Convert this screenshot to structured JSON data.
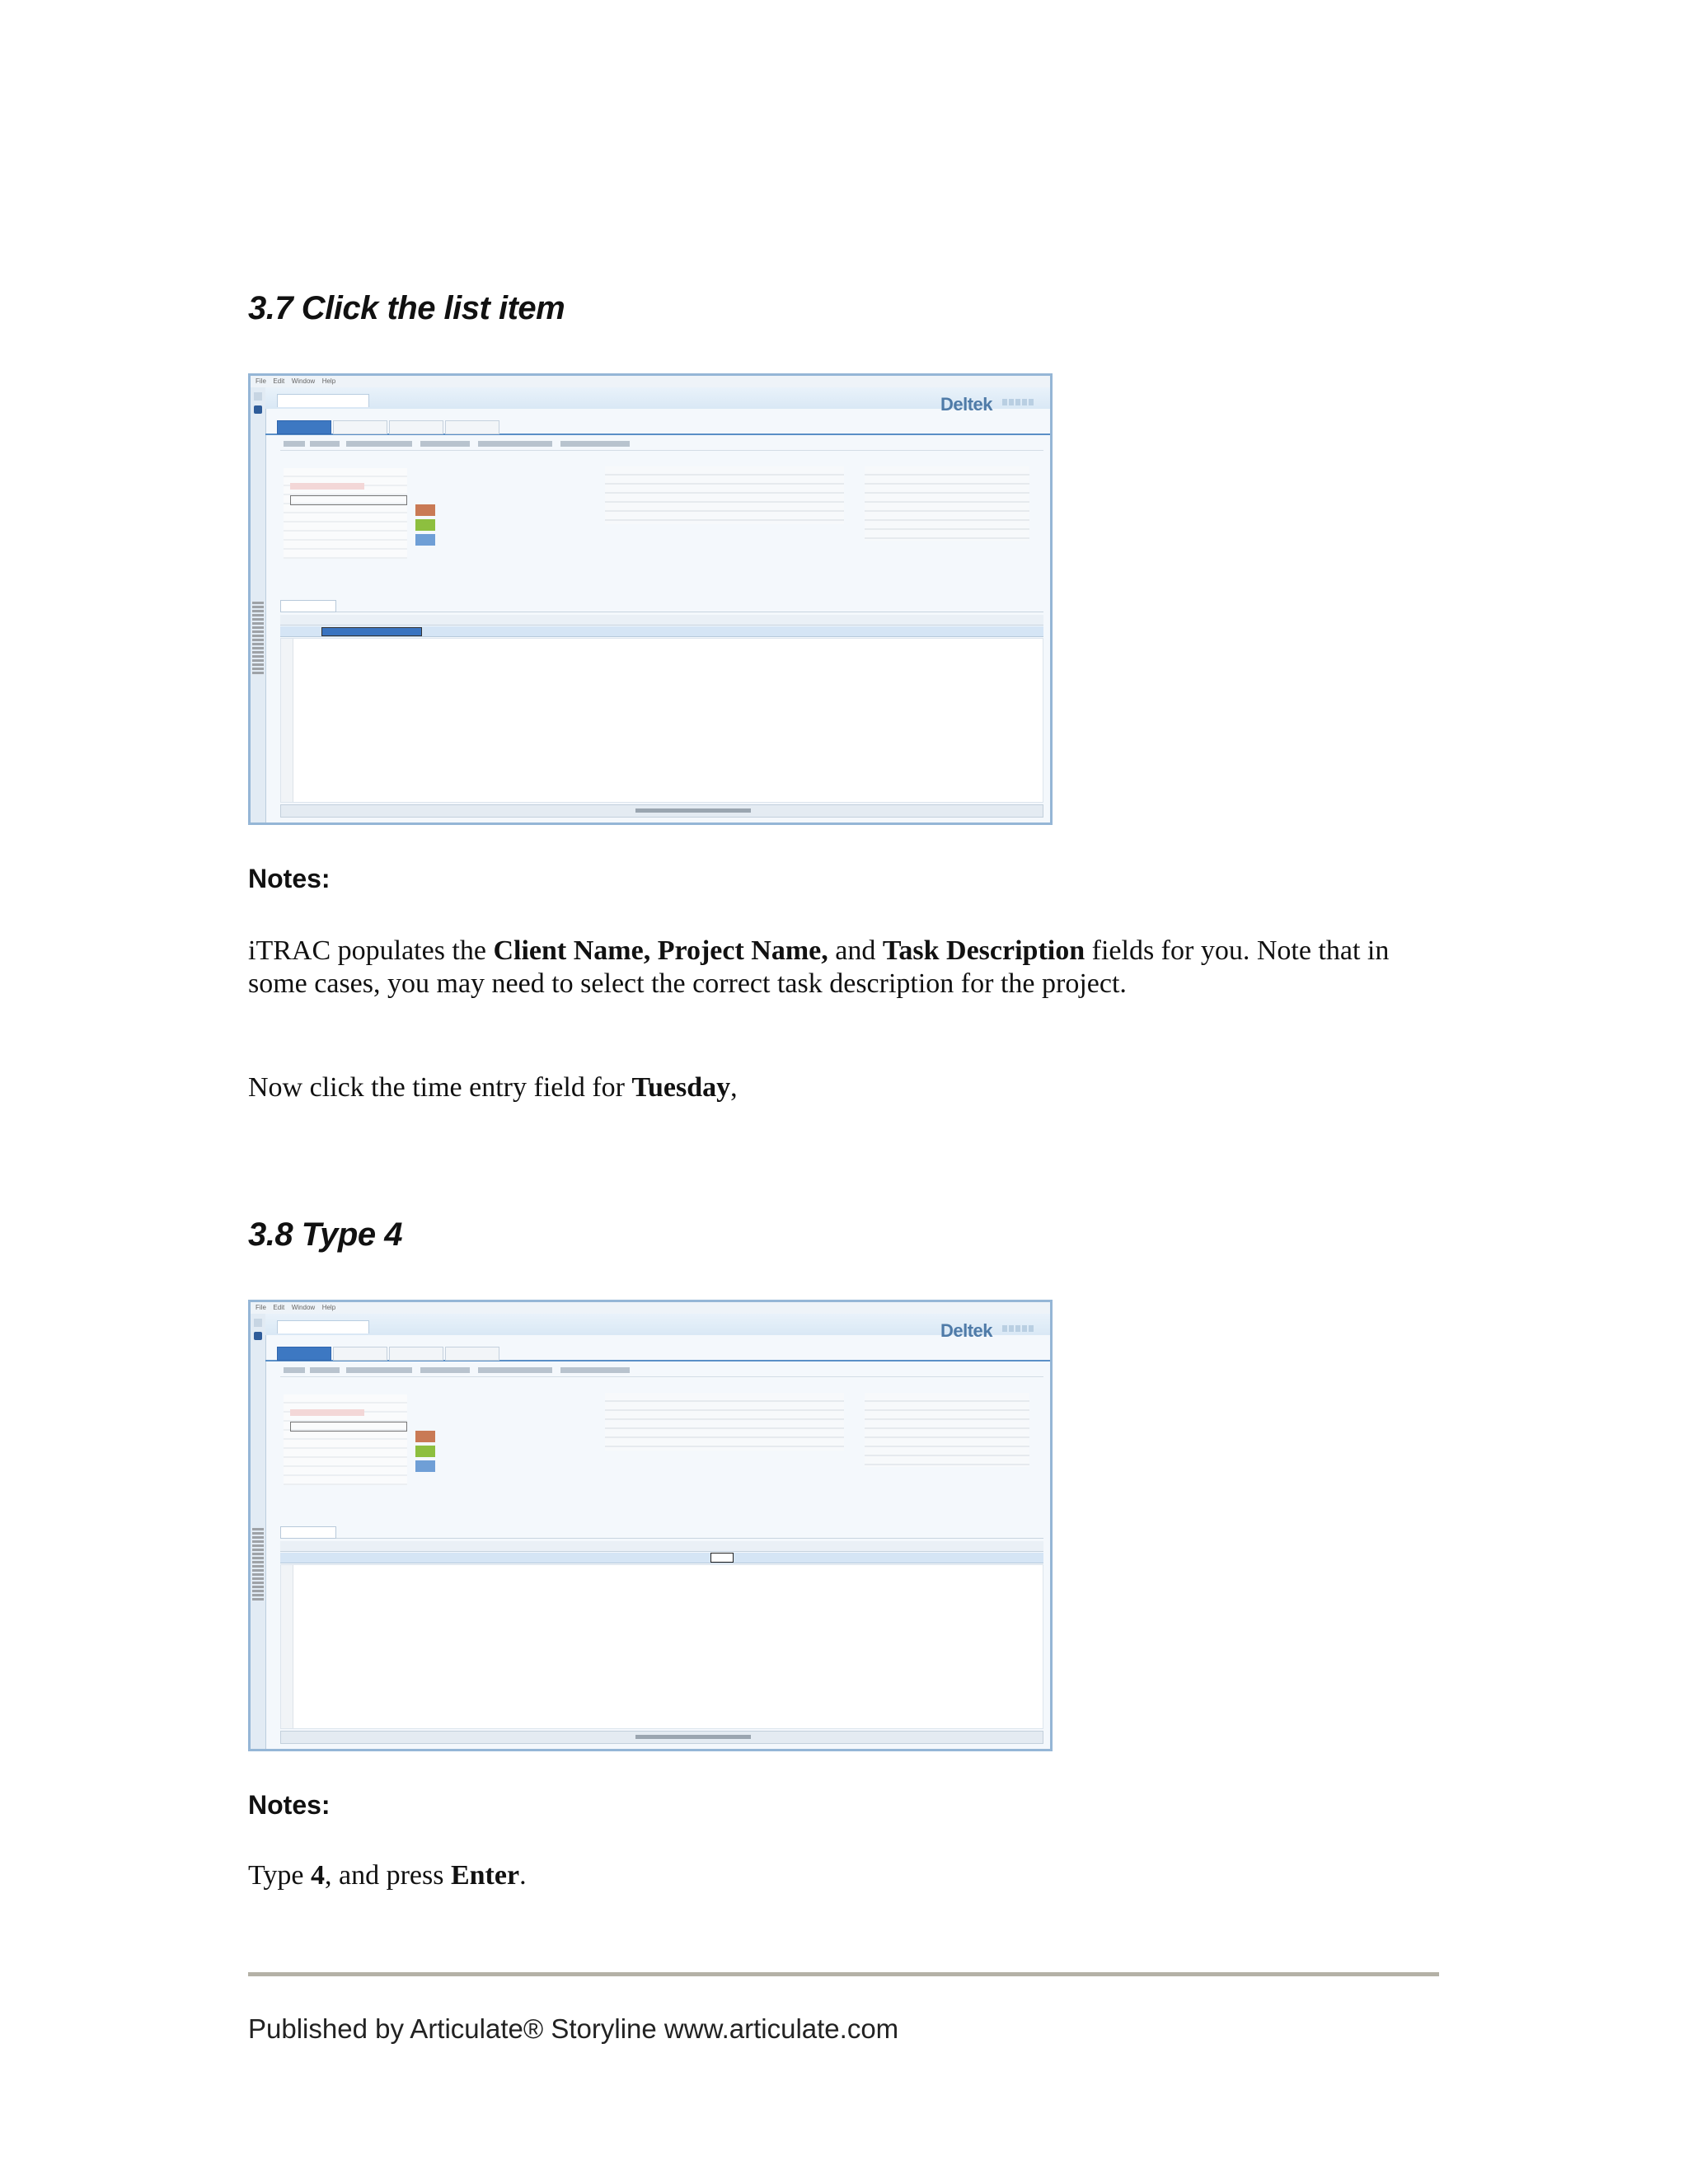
{
  "section_1": {
    "heading": "3.7 Click the list item",
    "notes_label": "Notes:",
    "p1": {
      "t1": "iTRAC populates the ",
      "b1": "Client Name, Project Name,",
      "t2": " and ",
      "b2": "Task Description",
      "t3": " fields for you.  Note that in some cases, you may need to select the correct task description  for the project."
    },
    "p2": {
      "t1": "Now click the time entry field for ",
      "b1": "Tuesday",
      "t2": ","
    }
  },
  "section_2": {
    "heading": "3.8 Type 4",
    "notes_label": "Notes:",
    "p1": {
      "t1": "Type ",
      "b1": "4",
      "t2": ", and press ",
      "b2": "Enter",
      "t3": "."
    }
  },
  "screenshot": {
    "brand": "Deltek",
    "menu": [
      "File",
      "Edit",
      "Window",
      "Help"
    ]
  },
  "colors": {
    "legend": [
      "#c97a55",
      "#8dbf3f",
      "#6f9fd6"
    ],
    "rule": "#b4b1a6"
  },
  "footer": {
    "text": "Published by Articulate® Storyline www.articulate.com"
  }
}
